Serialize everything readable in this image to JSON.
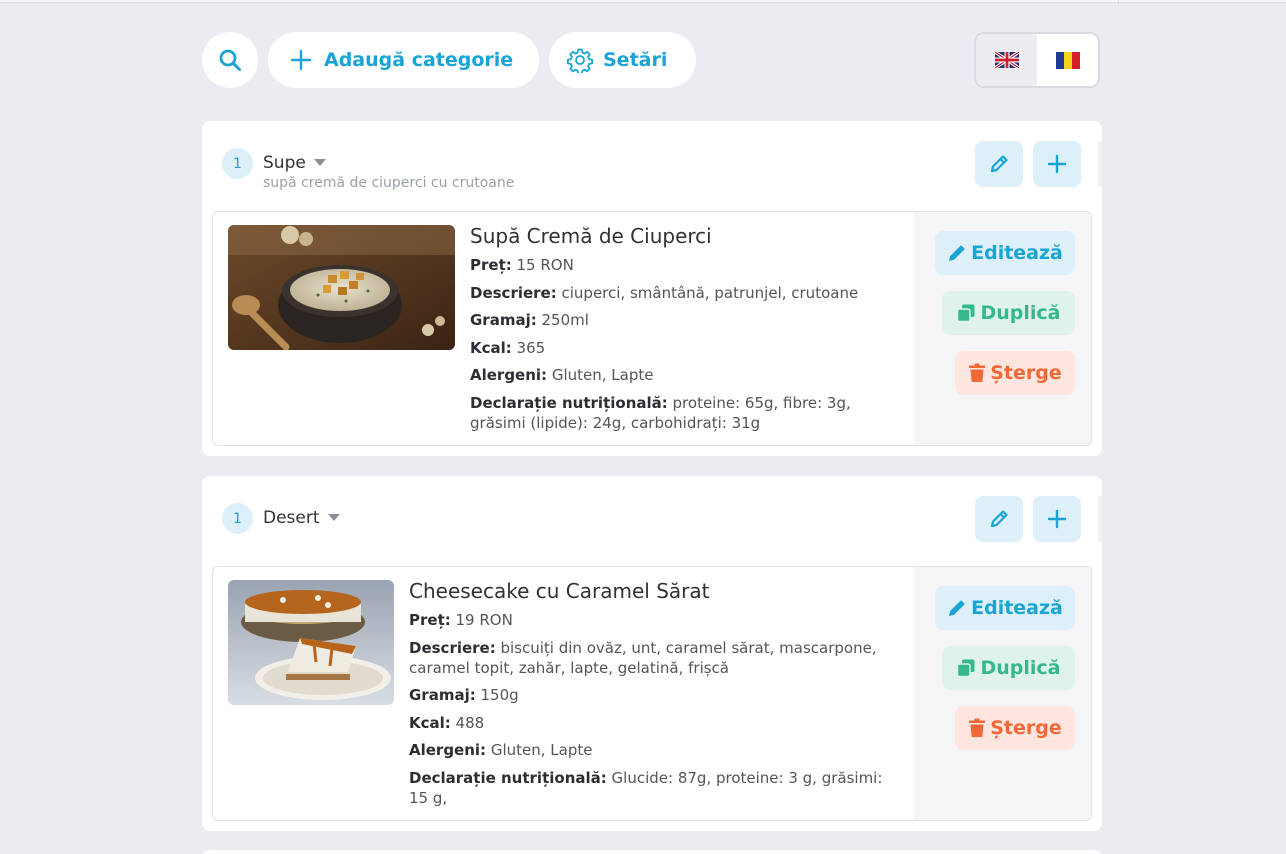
{
  "toolbar": {
    "search_icon": "search-icon",
    "add_category_label": "Adaugă categorie",
    "settings_label": "Setări"
  },
  "languages": [
    {
      "code": "en",
      "flag": "uk-flag-icon"
    },
    {
      "code": "ro",
      "flag": "romania-flag-icon"
    }
  ],
  "colors": {
    "accent": "#1aa4d6",
    "duplicate": "#33b98a",
    "delete": "#f26736",
    "background": "#ebebf1"
  },
  "categories": [
    {
      "number": "1",
      "name": "Supe",
      "subtitle": "supă cremă de ciuperci cu crutoane",
      "items": [
        {
          "title": "Supă Cremă de Ciuperci",
          "price_label": "Preț:",
          "price": " 15 RON",
          "description_label": "Descriere:",
          "description": " ciuperci, smântână, patrunjel, crutoane",
          "weight_label": "Gramaj:",
          "weight": " 250ml",
          "kcal_label": "Kcal:",
          "kcal": " 365",
          "allergens_label": "Alergeni:",
          "allergens": " Gluten, Lapte",
          "nutrition_label": "Declarație nutrițională:",
          "nutrition": " proteine: 65g, fibre: 3g, grăsimi (lipide): 24g, carbohidrați: 31g"
        }
      ]
    },
    {
      "number": "1",
      "name": "Desert",
      "subtitle": "",
      "items": [
        {
          "title": "Cheesecake cu Caramel Sărat",
          "price_label": "Preț:",
          "price": " 19 RON",
          "description_label": "Descriere:",
          "description": " biscuiți din ovăz, unt, caramel sărat, mascarpone, caramel topit, zahăr, lapte, gelatină, frișcă",
          "weight_label": "Gramaj:",
          "weight": " 150g",
          "kcal_label": "Kcal:",
          "kcal": " 488",
          "allergens_label": "Alergeni:",
          "allergens": " Gluten, Lapte",
          "nutrition_label": "Declarație nutrițională:",
          "nutrition": " Glucide: 87g, proteine: 3 g, grăsimi: 15 g,"
        }
      ]
    }
  ],
  "actions": {
    "edit_label": "Editează",
    "duplicate_label": "Duplică",
    "delete_label": "Șterge"
  }
}
